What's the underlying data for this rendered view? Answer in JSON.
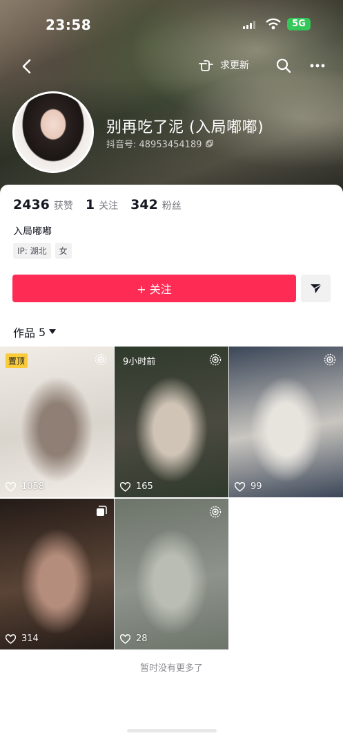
{
  "status_bar": {
    "time": "23:58",
    "network": "5G"
  },
  "nav": {
    "request_update_label": "求更新"
  },
  "profile": {
    "nickname": "别再吃了泥 (入局嘟嘟)",
    "douyin_id": "抖音号: 48953454189",
    "stats": [
      {
        "value": "2436",
        "label": "获赞"
      },
      {
        "value": "1",
        "label": "关注"
      },
      {
        "value": "342",
        "label": "粉丝"
      }
    ],
    "bio": "入局嘟嘟",
    "tags": [
      "IP: 湖北",
      "女"
    ]
  },
  "actions": {
    "follow_label": "+ 关注"
  },
  "works_header": {
    "label": "作品",
    "count": "5"
  },
  "videos": [
    {
      "likes": "1058",
      "badge": "置顶",
      "colors": [
        "#d9d4cc",
        "#8f7f74",
        "#f1ece6"
      ]
    },
    {
      "likes": "165",
      "badge": "9小时前",
      "colors": [
        "#4b4a40",
        "#cfc4b6",
        "#2f3a2c"
      ]
    },
    {
      "likes": "99",
      "badge": "",
      "colors": [
        "#c9c6c0",
        "#e7e4de",
        "#3b4658"
      ]
    },
    {
      "likes": "314",
      "badge": "",
      "colors": [
        "#5a4436",
        "#b58d7c",
        "#241b17"
      ]
    },
    {
      "likes": "28",
      "badge": "",
      "colors": [
        "#8e948c",
        "#b9bdb4",
        "#6d746a"
      ]
    }
  ],
  "footer": {
    "no_more": "暂时没有更多了"
  },
  "colors": {
    "accent": "#fe2c55",
    "pin": "#facb3b",
    "battery": "#34c759"
  }
}
